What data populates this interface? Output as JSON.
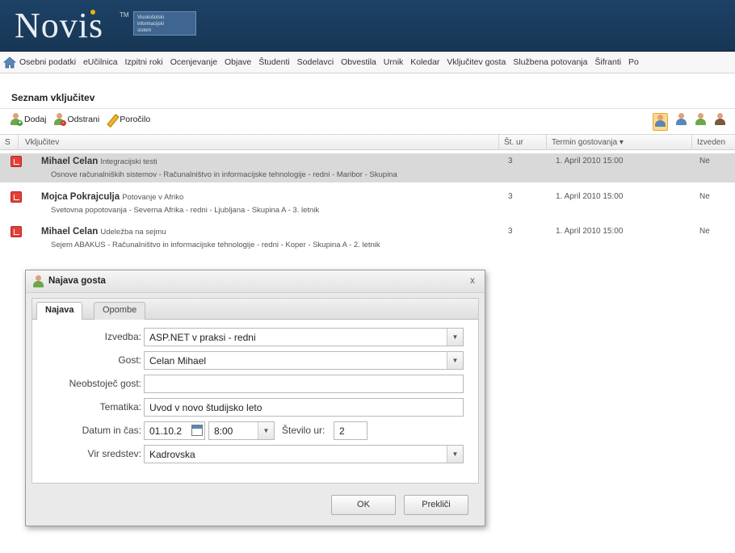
{
  "header": {
    "logo": "Novis",
    "trademark": "TM",
    "logo_subtitle": [
      "Visokošolski",
      "informacijski",
      "sistem"
    ]
  },
  "nav": {
    "items": [
      "Osebni podatki",
      "eUčilnica",
      "Izpitni roki",
      "Ocenjevanje",
      "Objave",
      "Študenti",
      "Sodelavci",
      "Obvestila",
      "Urnik",
      "Koledar",
      "Vključitev gosta",
      "Službena potovanja",
      "Šifranti",
      "Po"
    ]
  },
  "section_title": "Seznam vključitev",
  "toolbar": {
    "add": "Dodaj",
    "remove": "Odstrani",
    "report": "Poročilo"
  },
  "grid": {
    "columns": {
      "s": "S",
      "inclusion": "Vključitev",
      "hours": "Št. ur",
      "term": "Termin gostovanja ▾",
      "done": "Izveden"
    },
    "rows": [
      {
        "name": "Mihael Celan",
        "topic": "Integracijski testi",
        "detail": "Osnove računalniških sistemov - Računalništvo in informacijske tehnologije - redni - Maribor - Skupina",
        "hours": "3",
        "term": "1. April 2010 15:00",
        "done": "Ne"
      },
      {
        "name": "Mojca Pokrajculja",
        "topic": "Potovanje v Afriko",
        "detail": "Svetovna popotovanja - Severna Afrika - redni - Ljubljana - Skupina A - 3. letnik",
        "hours": "3",
        "term": "1. April 2010 15:00",
        "done": "Ne"
      },
      {
        "name": "Mihael Celan",
        "topic": "Udeležba na sejmu",
        "detail": "Sejem ABAKUS - Računalništvo in informacijske tehnologije - redni - Koper - Skupina A - 2. letnik",
        "hours": "3",
        "term": "1. April 2010 15:00",
        "done": "Ne"
      }
    ]
  },
  "dialog": {
    "title": "Najava gosta",
    "close": "x",
    "tabs": [
      "Najava",
      "Opombe"
    ],
    "fields": {
      "izvedba": {
        "label": "Izvedba:",
        "value": "ASP.NET v praksi - redni"
      },
      "gost": {
        "label": "Gost:",
        "value": "Celan Mihael"
      },
      "neobstojec": {
        "label": "Neobstoječ gost:",
        "value": ""
      },
      "tematika": {
        "label": "Tematika:",
        "value": "Uvod v novo študijsko leto"
      },
      "datum": {
        "label": "Datum in čas:",
        "date": "01.10.2",
        "time": "8:00"
      },
      "stevilo": {
        "label": "Število ur:",
        "value": "2"
      },
      "vir": {
        "label": "Vir sredstev:",
        "value": "Kadrovska"
      }
    },
    "buttons": {
      "ok": "OK",
      "cancel": "Prekliči"
    }
  }
}
